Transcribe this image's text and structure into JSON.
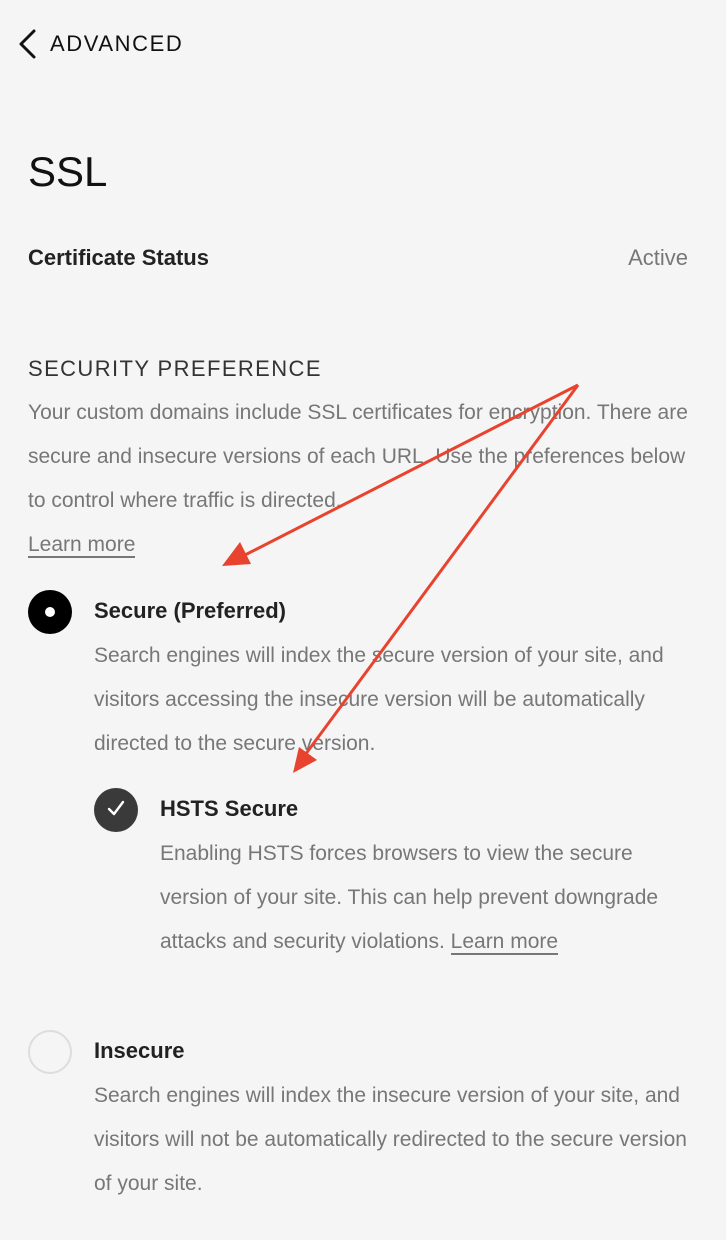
{
  "header": {
    "back_label": "ADVANCED"
  },
  "page_title": "SSL",
  "certificate": {
    "label": "Certificate Status",
    "value": "Active"
  },
  "security": {
    "heading": "SECURITY PREFERENCE",
    "description": "Your custom domains include SSL certificates for encryption. There are secure and insecure versions of each URL. Use the preferences below to control where traffic is directed.",
    "learn_more": "Learn more",
    "options": [
      {
        "label": "Secure (Preferred)",
        "description": "Search engines will index the secure version of your site, and visitors accessing the insecure version will be automatically directed to the secure version.",
        "selected": true
      },
      {
        "label": "Insecure",
        "description": "Search engines will index the insecure version of your site, and visitors will not be automatically redirected to the secure version of your site.",
        "selected": false
      }
    ],
    "hsts": {
      "label": "HSTS Secure",
      "description": "Enabling HSTS forces browsers to view the secure version of your site. This can help prevent downgrade attacks and security violations.",
      "learn_more": "Learn more",
      "checked": true
    }
  },
  "colors": {
    "background": "#f5f5f5",
    "text_primary": "#222222",
    "text_secondary": "#777777",
    "annotation_arrow": "#e8432e"
  }
}
